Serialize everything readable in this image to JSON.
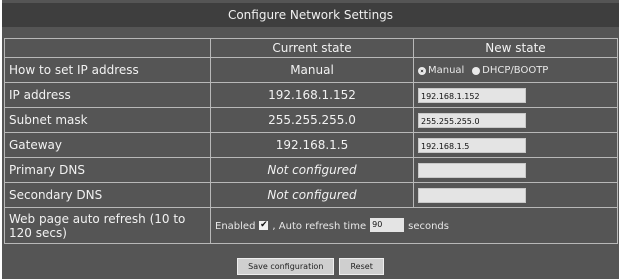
{
  "title": "Configure Network Settings",
  "headers": {
    "current": "Current state",
    "new": "New state"
  },
  "rows": {
    "how": {
      "label": "How to set IP address",
      "current": "Manual",
      "options": [
        "Manual",
        "DHCP/BOOTP"
      ],
      "selected": "Manual"
    },
    "ip": {
      "label": "IP address",
      "current": "192.168.1.152",
      "value": "192.168.1.152"
    },
    "subnet": {
      "label": "Subnet mask",
      "current": "255.255.255.0",
      "value": "255.255.255.0"
    },
    "gateway": {
      "label": "Gateway",
      "current": "192.168.1.5",
      "value": "192.168.1.5"
    },
    "pdns": {
      "label": "Primary DNS",
      "current": "Not configured",
      "value": ""
    },
    "sdns": {
      "label": "Secondary DNS",
      "current": "Not configured",
      "value": ""
    },
    "refresh": {
      "label": "Web page auto refresh (10 to 120 secs)",
      "enabled_label": "Enabled",
      "checked": true,
      "time_label": ", Auto refresh time",
      "time_value": "90",
      "unit": "seconds"
    }
  },
  "buttons": {
    "save": "Save configuration",
    "reset": "Reset"
  }
}
